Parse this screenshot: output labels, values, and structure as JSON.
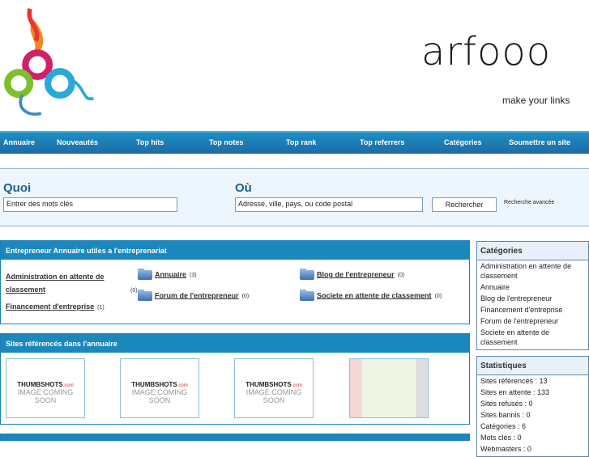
{
  "header": {
    "brand": "arfooo",
    "tagline": "make your links"
  },
  "nav": [
    "Annuaire",
    "Nouveautés",
    "Top hits",
    "Top notes",
    "Top rank",
    "Top referrers",
    "Catégories",
    "Soumettre un site"
  ],
  "search": {
    "quoi_label": "Quoi",
    "quoi_placeholder": "Entrer des mots clés",
    "ou_label": "Où",
    "ou_placeholder": "Adresse, ville, pays, ou code postal",
    "button": "Rechercher",
    "advanced": "Recherche avancée"
  },
  "categories_panel": {
    "title": "Entrepreneur Annuaire utiles a l'entreprenariat",
    "items": [
      {
        "name": "Administration en attente de classement",
        "count": "(0)"
      },
      {
        "name": "Financement d'entreprise",
        "count": "(1)"
      },
      {
        "name": "Annuaire",
        "count": "(3)"
      },
      {
        "name": "Forum de l'entrepreneur",
        "count": "(0)"
      },
      {
        "name": "Blog de l'entrepreneur",
        "count": "(0)"
      },
      {
        "name": "Societe en attente de classement",
        "count": "(0)"
      }
    ]
  },
  "sites_panel": {
    "title": "Sites référencés dans l'annuaire",
    "thumb_brand": "THUMBSHOTS",
    "thumb_domain": ".com",
    "thumb_text": "IMAGE COMING SOON"
  },
  "sidebar": {
    "categories_title": "Catégories",
    "categories": [
      "Administration en attente de classement",
      "Annuaire",
      "Blog de l'entrepreneur",
      "Financement d'entreprise",
      "Forum de l'entrepreneur",
      "Societe en attente de classement"
    ],
    "stats_title": "Statistiques",
    "stats": [
      "Sites référencés : 13",
      "Sites en attente : 133",
      "Sites refusés : 0",
      "Sites bannis : 0",
      "Catégories : 6",
      "Mots clés : 0",
      "Webmasters : 0"
    ]
  }
}
